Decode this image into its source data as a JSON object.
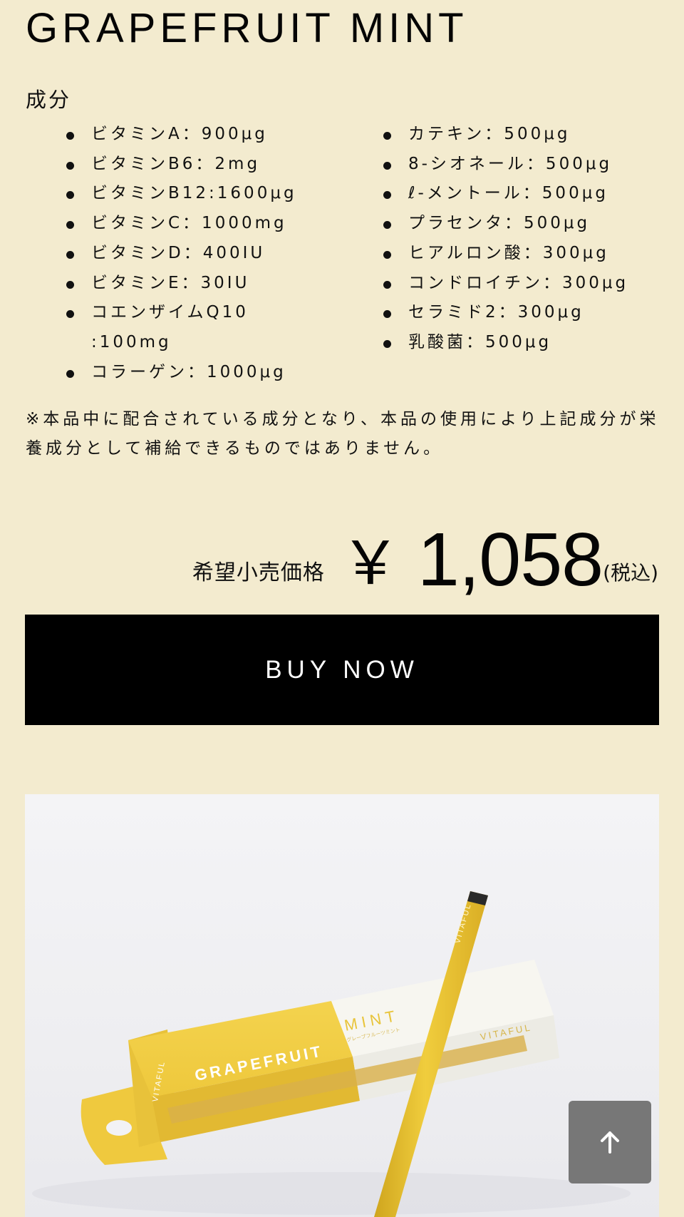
{
  "product": {
    "title": "GRAPEFRUIT MINT"
  },
  "ingredients": {
    "heading": "成分",
    "left": [
      "ビタミンA：900μg",
      "ビタミンB6：2mg",
      "ビタミンB12:1600μg",
      "ビタミンC：1000mg",
      "ビタミンD：400IU",
      "ビタミンE：30IU",
      "コエンザイムQ10 :100mg",
      "コラーゲン：1000μg"
    ],
    "right": [
      "カテキン：500μg",
      "8-シオネール：500μg",
      "ℓ-メントール：500μg",
      "プラセンタ：500μg",
      "ヒアルロン酸：300μg",
      "コンドロイチン：300μg",
      "セラミド2：300μg",
      "乳酸菌：500μg"
    ]
  },
  "note": "※本品中に配合されている成分となり、本品の使用により上記成分が栄養成分として補給できるものではありません。",
  "price": {
    "label": "希望小売価格",
    "currency": "￥",
    "amount": "1,058",
    "tax": "(税込)"
  },
  "buy_button": {
    "label": "BUY NOW"
  },
  "photo": {
    "box_brand_side": "VITAFUL",
    "box_flavor_main": "GRAPEFRUIT",
    "box_flavor_accent": "MINT",
    "box_flavor_small": "グレープフルーツミント",
    "pen_brand": "VITAFUL",
    "colors": {
      "box_yellow": "#f0cf45",
      "pen_yellow": "#e8c130",
      "box_white": "#f7f6f0"
    }
  },
  "back_to_top": {
    "icon": "arrow-up-icon"
  },
  "colors": {
    "page_background": "#f3ebcf",
    "button_background": "#000000",
    "back_to_top_background": "#777777"
  }
}
